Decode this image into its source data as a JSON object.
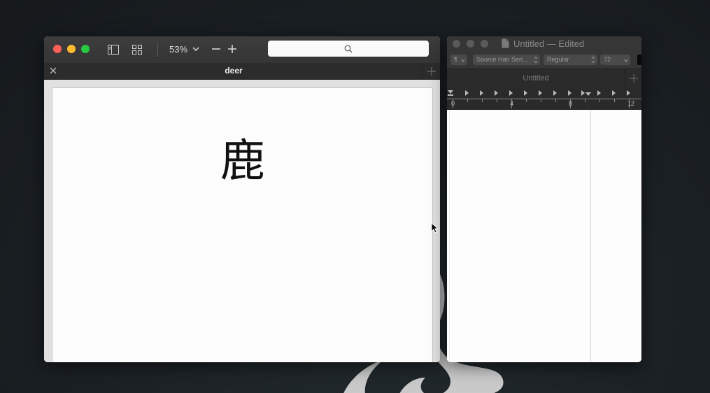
{
  "preview": {
    "zoom_level": "53%",
    "search_placeholder": "",
    "tab_title": "deer",
    "document_text": "鹿"
  },
  "textedit": {
    "window_title": "Untitled — Edited",
    "paragraph_style": "¶",
    "font_family": "Source Han Seri...",
    "font_style": "Regular",
    "font_size": "72",
    "tab_title": "Untitled",
    "ruler_marks": [
      "0",
      "4",
      "8",
      "12"
    ]
  },
  "colors": {
    "close": "#fc5f57",
    "minimize": "#fdbc2e",
    "zoom": "#28c840"
  }
}
